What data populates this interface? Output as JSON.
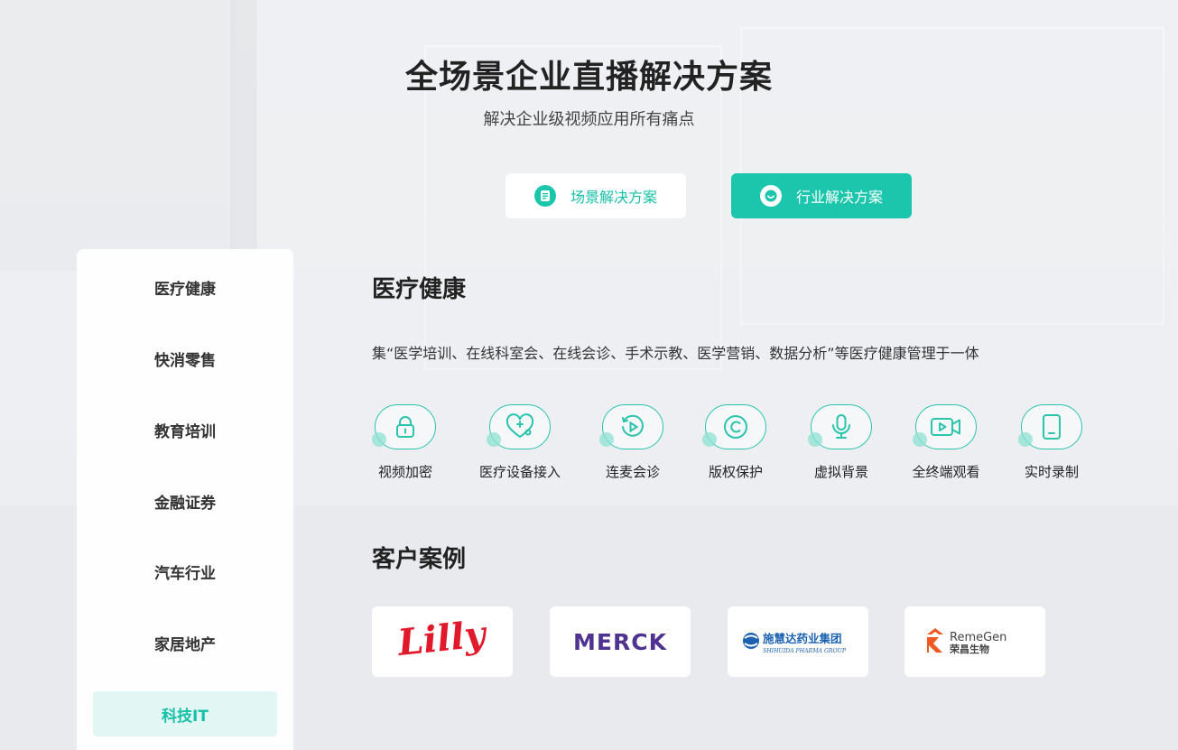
{
  "header": {
    "title": "全场景企业直播解决方案",
    "subtitle": "解决企业级视频应用所有痛点"
  },
  "tabs": [
    {
      "label": "场景解决方案",
      "icon": "document-icon",
      "active": false
    },
    {
      "label": "行业解决方案",
      "icon": "smile-icon",
      "active": true
    }
  ],
  "sidebar": {
    "items": [
      {
        "label": "医疗健康",
        "active": false
      },
      {
        "label": "快消零售",
        "active": false
      },
      {
        "label": "教育培训",
        "active": false
      },
      {
        "label": "金融证券",
        "active": false
      },
      {
        "label": "汽车行业",
        "active": false
      },
      {
        "label": "家居地产",
        "active": false
      },
      {
        "label": "科技IT",
        "active": true
      }
    ]
  },
  "main": {
    "section_title": "医疗健康",
    "description": "集“医学培训、在线科室会、在线会诊、手术示教、医学营销、数据分析”等医疗健康管理于一体",
    "features": [
      {
        "label": "视频加密",
        "icon": "lock-icon"
      },
      {
        "label": "医疗设备接入",
        "icon": "heart-stethoscope-icon"
      },
      {
        "label": "连麦会诊",
        "icon": "replay-icon"
      },
      {
        "label": "版权保护",
        "icon": "copyright-icon"
      },
      {
        "label": "虚拟背景",
        "icon": "microphone-icon"
      },
      {
        "label": "全终端观看",
        "icon": "video-camera-icon"
      },
      {
        "label": "实时录制",
        "icon": "tablet-icon"
      }
    ],
    "cases_title": "客户案例",
    "clients": [
      {
        "name": "Lilly",
        "logo": "lilly-logo"
      },
      {
        "name": "MERCK",
        "logo": "merck-logo"
      },
      {
        "name": "施慧达药业集团",
        "sub": "SHIHUIDA PHARMA GROUP",
        "logo": "shihuida-logo"
      },
      {
        "name": "RemeGen",
        "sub": "荣昌生物",
        "logo": "remegen-logo"
      }
    ]
  },
  "colors": {
    "accent": "#1cc6ad",
    "accent_light": "#e2f7f3",
    "text": "#222222"
  }
}
